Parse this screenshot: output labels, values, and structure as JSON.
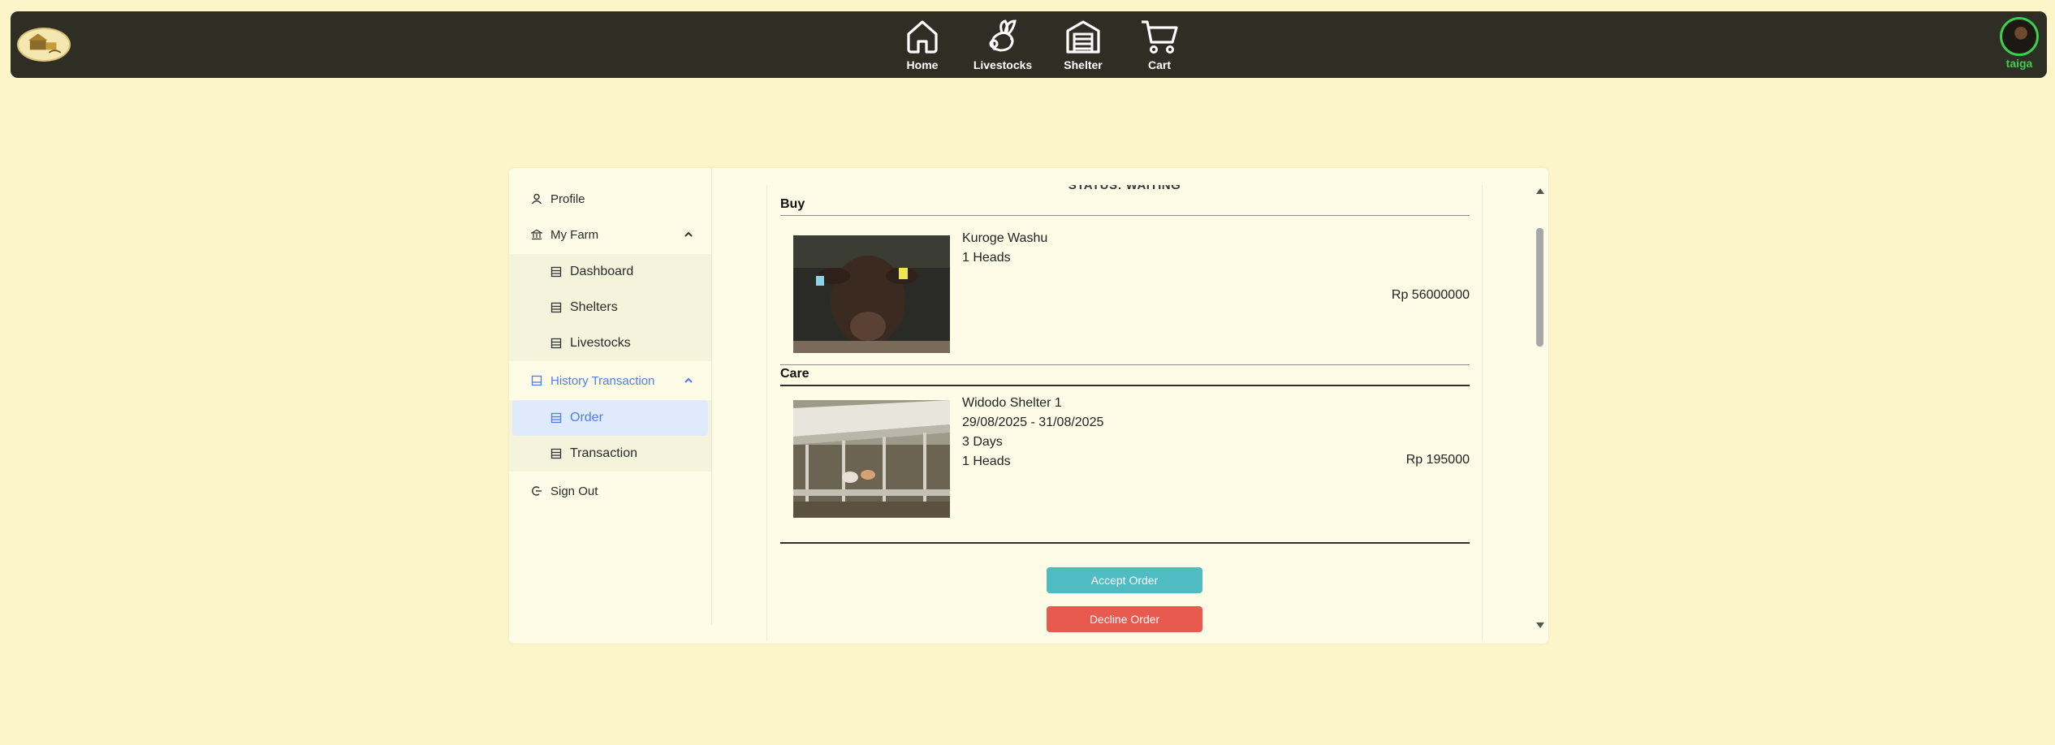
{
  "nav": {
    "items": [
      {
        "label": "Home",
        "icon": "home-icon"
      },
      {
        "label": "Livestocks",
        "icon": "rabbit-icon"
      },
      {
        "label": "Shelter",
        "icon": "warehouse-icon"
      },
      {
        "label": "Cart",
        "icon": "cart-icon"
      }
    ],
    "user": {
      "name": "taiga"
    }
  },
  "sidebar": {
    "profile": "Profile",
    "my_farm": "My Farm",
    "my_farm_items": [
      "Dashboard",
      "Shelters",
      "Livestocks"
    ],
    "history": "History Transaction",
    "history_items": [
      "Order",
      "Transaction"
    ],
    "sign_out": "Sign Out"
  },
  "order": {
    "status": "STATUS: WAITING",
    "buy": {
      "title": "Buy",
      "name": "Kuroge Washu",
      "qty": "1 Heads",
      "price": "Rp 56000000"
    },
    "care": {
      "title": "Care",
      "name": "Widodo Shelter 1",
      "dates": "29/08/2025 - 31/08/2025",
      "days": "3 Days",
      "qty": "1 Heads",
      "price": "Rp 195000"
    },
    "accept_label": "Accept Order",
    "decline_label": "Decline Order"
  },
  "colors": {
    "background": "#fcf5c9",
    "navbar": "#2f2e25",
    "accent_blue": "#4f7ee8",
    "accept": "#4fbcc4",
    "decline": "#e95a4e",
    "user_online": "#3ccf4e"
  }
}
